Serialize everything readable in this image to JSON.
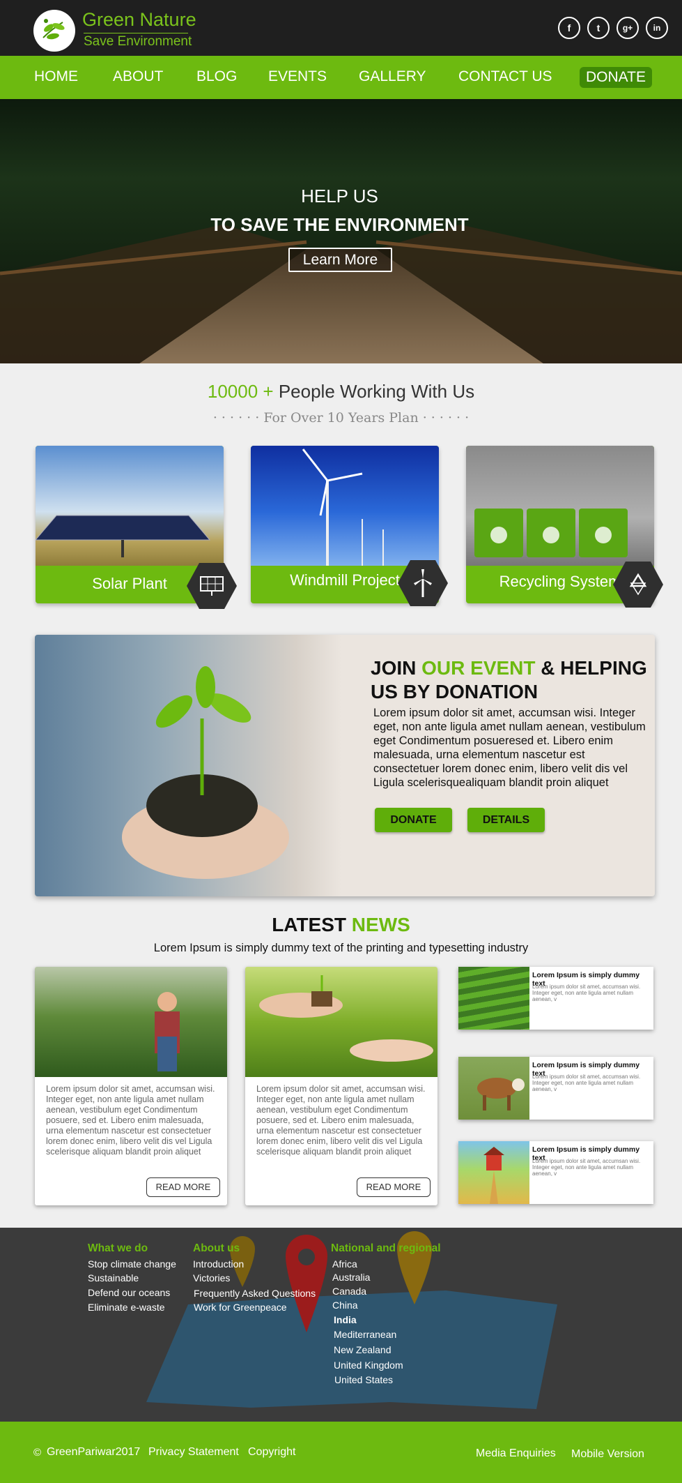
{
  "brand": {
    "name": "Green Nature",
    "tagline": "Save Environment"
  },
  "social": [
    {
      "icon": "facebook-icon",
      "glyph": "f"
    },
    {
      "icon": "twitter-icon",
      "glyph": "t"
    },
    {
      "icon": "google-plus-icon",
      "glyph": "g+"
    },
    {
      "icon": "linkedin-icon",
      "glyph": "in"
    }
  ],
  "nav": {
    "items": [
      "HOME",
      "ABOUT",
      "BLOG",
      "EVENTS",
      "GALLERY",
      "CONTACT US"
    ],
    "donate": "DONATE"
  },
  "hero": {
    "line1": "HELP US",
    "line2": "TO SAVE THE ENVIRONMENT",
    "button": "Learn More"
  },
  "stats": {
    "number": "10000 +",
    "text": "People Working With Us",
    "subtitle": "· · · · · ·  For Over 10 Years Plan  · · · · · ·"
  },
  "services": [
    {
      "label": "Solar Plant",
      "icon": "solar-panel-icon"
    },
    {
      "label": "Windmill Project",
      "icon": "wind-turbine-icon"
    },
    {
      "label": "Recycling System",
      "icon": "recycle-icon"
    }
  ],
  "event": {
    "title_part1": "JOIN ",
    "title_highlight": "OUR EVENT",
    "title_part2": " & HELPING US BY DONATION",
    "text": "Lorem ipsum dolor sit amet, accumsan wisi. Integer eget, non ante ligula amet nullam aenean, vestibulum eget Condimentum posueresed et. Libero enim malesuada, urna elementum nascetur est consectetuer lorem donec enim, libero velit dis vel Ligula scelerisquealiquam blandit proin aliquet",
    "donate_button": "DONATE",
    "details_button": "DETAILS"
  },
  "news": {
    "title_part1": "LATEST ",
    "title_highlight": "NEWS",
    "subtitle": "Lorem Ipsum is simply dummy text of the printing and typesetting industry",
    "cards": [
      {
        "text": "Lorem ipsum dolor sit amet, accumsan wisi. Integer eget, non ante ligula amet nullam aenean, vestibulum eget Condimentum posuere, sed et. Libero enim malesuada, urna elementum nascetur est consectetuer lorem donec enim, libero velit dis vel Ligula scelerisque aliquam blandit proin aliquet",
        "button": "READ MORE"
      },
      {
        "text": "Lorem ipsum dolor sit amet, accumsan wisi. Integer eget, non ante ligula amet nullam aenean, vestibulum eget Condimentum posuere, sed et. Libero enim malesuada, urna elementum nascetur est consectetuer lorem donec enim, libero velit dis vel Ligula scelerisque aliquam blandit proin aliquet",
        "button": "READ MORE"
      }
    ],
    "small": [
      {
        "title": "Lorem Ipsum is simply dummy text",
        "text": "Lorem ipsum dolor sit amet, accumsan wisi. Integer eget, non ante ligula amet nullam aenean, v"
      },
      {
        "title": "Lorem Ipsum is simply dummy text",
        "text": "Lorem ipsum dolor sit amet, accumsan wisi. Integer eget, non ante ligula amet nullam aenean, v"
      },
      {
        "title": "Lorem Ipsum is simply dummy text",
        "text": "Lorem ipsum dolor sit amet, accumsan wisi. Integer eget, non ante ligula amet nullam aenean, v"
      }
    ]
  },
  "footer": {
    "col1": {
      "heading": "What we do",
      "links": [
        "Stop climate change",
        "Sustainable",
        "Defend our oceans",
        "Eliminate e-waste"
      ]
    },
    "col2": {
      "heading": "About us",
      "links": [
        "Introduction",
        "Victories",
        "Frequently Asked Questions",
        "Work for Greenpeace"
      ]
    },
    "col3": {
      "heading": "National and regional",
      "links": [
        "Africa",
        "Australia",
        "Canada",
        "China",
        "India",
        "Mediterranean",
        "New Zealand",
        "United Kingdom",
        "United States"
      ]
    }
  },
  "bottom": {
    "copyright_symbol": "©",
    "copyright": "GreenPariwar2017",
    "privacy": "Privacy Statement",
    "copyright_link": "Copyright",
    "media": "Media Enquiries",
    "mobile": "Mobile Version"
  },
  "colors": {
    "brand_green": "#6dba10",
    "dark": "#1f1f1f"
  }
}
